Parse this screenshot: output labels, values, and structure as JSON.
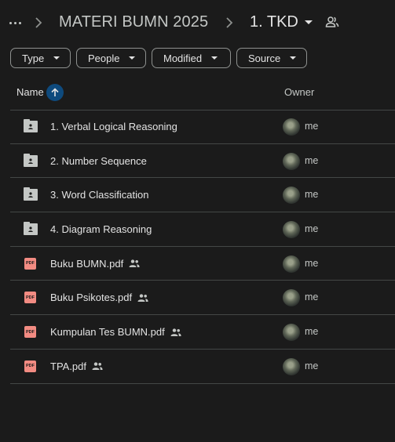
{
  "breadcrumb": {
    "items": [
      "MATERI BUMN 2025"
    ],
    "current": "1. TKD"
  },
  "filters": [
    "Type",
    "People",
    "Modified",
    "Source"
  ],
  "columns": {
    "name": "Name",
    "owner": "Owner"
  },
  "files": [
    {
      "name": "1. Verbal Logical Reasoning",
      "kind": "folder-icon",
      "shared": false,
      "owner": "me"
    },
    {
      "name": "2. Number Sequence",
      "kind": "folder-icon",
      "shared": false,
      "owner": "me"
    },
    {
      "name": "3. Word Classification",
      "kind": "folder-icon",
      "shared": false,
      "owner": "me"
    },
    {
      "name": "4. Diagram Reasoning",
      "kind": "folder-icon",
      "shared": false,
      "owner": "me"
    },
    {
      "name": "Buku BUMN.pdf",
      "kind": "pdf-icon",
      "shared": true,
      "owner": "me"
    },
    {
      "name": "Buku Psikotes.pdf",
      "kind": "pdf-icon",
      "shared": true,
      "owner": "me"
    },
    {
      "name": "Kumpulan Tes BUMN.pdf",
      "kind": "pdf-icon",
      "shared": true,
      "owner": "me"
    },
    {
      "name": "TPA.pdf",
      "kind": "pdf-icon",
      "shared": true,
      "owner": "me"
    }
  ],
  "icons": {
    "pdf_label": "PDF"
  },
  "colors": {
    "background": "#1b1b1b",
    "sort_accent": "#0e4a7d",
    "pdf": "#f28b82"
  }
}
